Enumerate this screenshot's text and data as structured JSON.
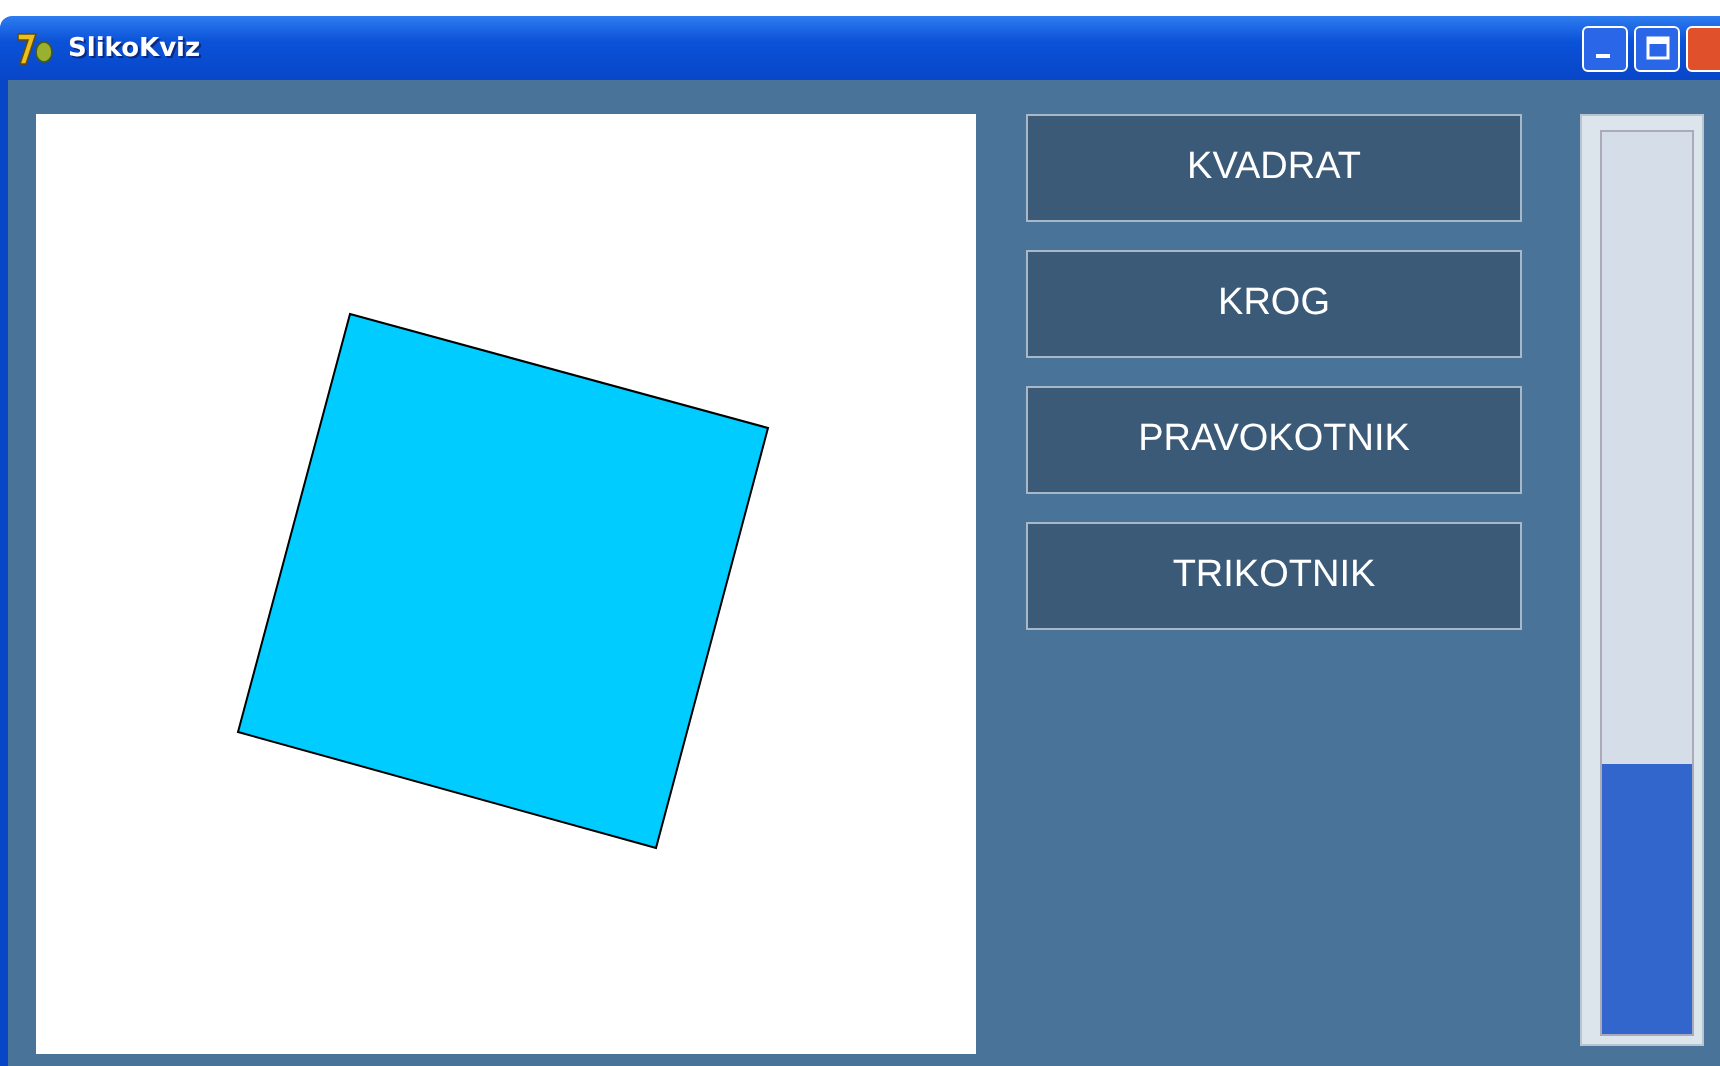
{
  "window": {
    "title": "SlikoKviz"
  },
  "buttons": [
    {
      "label": "KVADRAT"
    },
    {
      "label": "KROG"
    },
    {
      "label": "PRAVOKOTNIK"
    },
    {
      "label": "TRIKOTNIK"
    }
  ],
  "progress": {
    "level": 0.3
  }
}
